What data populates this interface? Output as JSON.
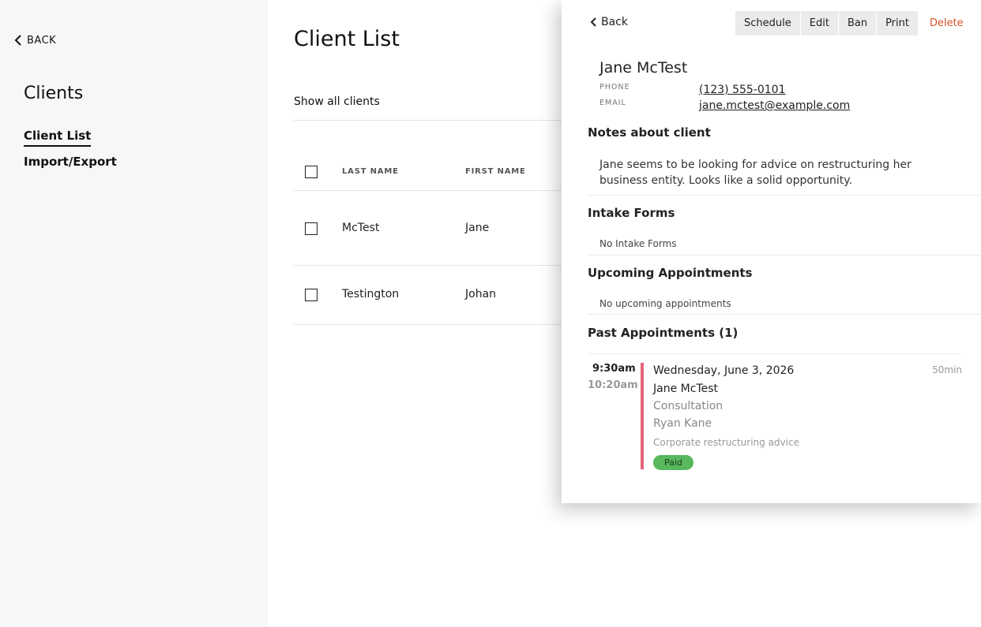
{
  "sidebar": {
    "back_label": "BACK",
    "title": "Clients",
    "nav": [
      {
        "label": "Client List"
      },
      {
        "label": "Import/Export"
      }
    ]
  },
  "main": {
    "title": "Client List",
    "filter_label": "Show all clients",
    "table": {
      "headers": {
        "last_name": "LAST NAME",
        "first_name": "FIRST NAME"
      },
      "rows": [
        {
          "last_name": "McTest",
          "first_name": "Jane"
        },
        {
          "last_name": "Testington",
          "first_name": "Johan"
        }
      ]
    }
  },
  "panel": {
    "back_label": "Back",
    "toolbar": {
      "schedule": "Schedule",
      "edit": "Edit",
      "ban": "Ban",
      "print": "Print",
      "delete": "Delete"
    },
    "client": {
      "name": "Jane McTest",
      "phone_label": "PHONE",
      "phone": "(123) 555-0101",
      "email_label": "EMAIL",
      "email": "jane.mctest@example.com"
    },
    "notes": {
      "title": "Notes about client",
      "text": "Jane seems to be looking for advice on restructuring her business entity. Looks like a solid opportunity."
    },
    "intake": {
      "title": "Intake Forms",
      "empty": "No Intake Forms"
    },
    "upcoming": {
      "title": "Upcoming Appointments",
      "empty": "No upcoming appointments"
    },
    "past": {
      "title": "Past Appointments (1)",
      "appointment": {
        "start": "9:30am",
        "end": "10:20am",
        "date": "Wednesday, June 3, 2026",
        "duration": "50min",
        "client": "Jane McTest",
        "type": "Consultation",
        "staff": "Ryan Kane",
        "note": "Corporate restructuring advice",
        "status": "Paid",
        "accent_color": "#e5637d",
        "status_color": "#57b85d"
      }
    }
  }
}
